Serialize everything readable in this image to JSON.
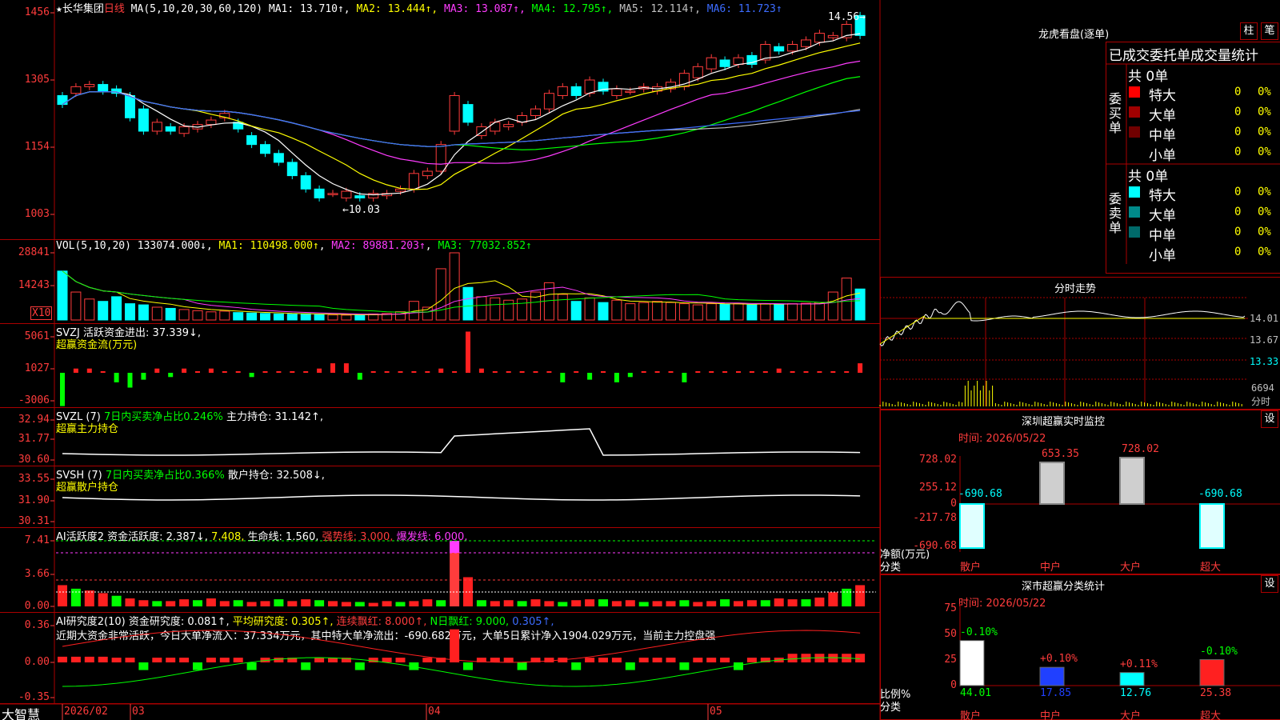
{
  "main": {
    "stock_name": "★长华集团",
    "period": "日线",
    "ma_label": "MA(5,10,20,30,60,120)",
    "ma_values": [
      {
        "name": "MA1",
        "value": "13.710",
        "arrow": "↑",
        "color": "#ffffff"
      },
      {
        "name": "MA2",
        "value": "13.444",
        "arrow": "↑",
        "color": "#ffff00"
      },
      {
        "name": "MA3",
        "value": "13.087",
        "arrow": "↑",
        "color": "#ff3cff"
      },
      {
        "name": "MA4",
        "value": "12.795",
        "arrow": "↑",
        "color": "#00ff00"
      },
      {
        "name": "MA5",
        "value": "12.114",
        "arrow": "↑",
        "color": "#c0c0c0"
      },
      {
        "name": "MA6",
        "value": "11.723",
        "arrow": "↑",
        "color": "#3c6cff"
      }
    ],
    "y_ticks": [
      "1456",
      "1305",
      "1154",
      "1003"
    ],
    "high_label": "14.56",
    "low_label": "10.03"
  },
  "vol": {
    "label": "VOL(5,10,20)",
    "value": "133074.000↓",
    "ma1": "MA1: 110498.000↑",
    "ma2": "MA2: 89881.203↑",
    "ma3": "MA3: 77032.852↑",
    "y_ticks": [
      "28841",
      "14243"
    ],
    "unit": "X10"
  },
  "svzj": {
    "label": "SVZJ",
    "text": "活跃资金进出: 37.339↓,",
    "sub": "超赢资金流(万元)",
    "y_ticks": [
      "5061",
      "1027",
      "-3006"
    ]
  },
  "svzl": {
    "label": "SVZL (7)",
    "text1": "7日内买卖净占比0.246%",
    "text2": "主力持仓: 31.142↑,",
    "sub": "超赢主力持仓",
    "y_ticks": [
      "32.94",
      "31.77",
      "30.60"
    ]
  },
  "svsh": {
    "label": "SVSH (7)",
    "text1": "7日内买卖净占比0.366%",
    "text2": "散户持仓: 32.508↓,",
    "sub": "超赢散户持仓",
    "y_ticks": [
      "33.55",
      "31.90",
      "30.31"
    ]
  },
  "ai1": {
    "label": "AI活跃度2",
    "text1": "资金活跃度: 2.387↓,",
    "text2": "7.408,",
    "text3": "生命线: 1.560,",
    "text4": "强势线: 3.000,",
    "text5": "爆发线: 6.000,",
    "y_ticks": [
      "7.41",
      "3.66",
      "0.00"
    ]
  },
  "ai2": {
    "label": "AI研究度2(10)",
    "text1": "资金研究度: 0.081↑,",
    "text2": "平均研究度: 0.305↑,",
    "text3": "连续飘红: 8.000↑,",
    "text4": "N日飘红: 9.000,",
    "text5": "0.305↑,",
    "comment": "近期大资金非常活跃，今日大单净流入：37.334万元，其中特大单净流出：-690.682万元，大单5日累计净入1904.029万元，当前主力控盘强",
    "y_ticks": [
      "0.36",
      "0.00",
      "-0.35"
    ]
  },
  "xaxis": {
    "brand": "大智慧",
    "labels": [
      "2026/02",
      "03",
      "04",
      "05"
    ]
  },
  "lhb": {
    "title": "龙虎看盘(逐单)",
    "btn1": "柱",
    "btn2": "笔",
    "header": "已成交委托单成交量统计",
    "buy_label": "委买单",
    "sell_label": "委卖单",
    "buy_total": "共 0单",
    "sell_total": "共 0单",
    "buy_rows": [
      {
        "name": "特大",
        "count": "0",
        "pct": "0%",
        "color": "#ff0000"
      },
      {
        "name": "大单",
        "count": "0",
        "pct": "0%",
        "color": "#a00000"
      },
      {
        "name": "中单",
        "count": "0",
        "pct": "0%",
        "color": "#700000"
      },
      {
        "name": "小单",
        "count": "0",
        "pct": "0%",
        "color": "#000000"
      }
    ],
    "sell_rows": [
      {
        "name": "特大",
        "count": "0",
        "pct": "0%",
        "color": "#00ffff"
      },
      {
        "name": "大单",
        "count": "0",
        "pct": "0%",
        "color": "#008a8a"
      },
      {
        "name": "中单",
        "count": "0",
        "pct": "0%",
        "color": "#006a6a"
      },
      {
        "name": "小单",
        "count": "0",
        "pct": "0%",
        "color": "#000000"
      }
    ]
  },
  "fs": {
    "title": "分时走势",
    "y_ticks": [
      "14.01",
      "13.67",
      "13.33"
    ],
    "vol_tick": "6694",
    "vol_label": "分时"
  },
  "szmon": {
    "title": "深圳超赢实时监控",
    "btn": "设",
    "time": "时间: 2026/05/22",
    "y_ticks": [
      "728.02",
      "255.12",
      "0",
      "-217.78",
      "-690.68"
    ],
    "y_label": "净额(万元)",
    "x_label": "分类",
    "bars": [
      {
        "name": "散户",
        "value": -690.68,
        "label": "-690.68"
      },
      {
        "name": "中户",
        "value": 653.35,
        "label": "653.35"
      },
      {
        "name": "大户",
        "value": 728.02,
        "label": "728.02"
      },
      {
        "name": "超大",
        "value": -690.68,
        "label": "-690.68"
      }
    ]
  },
  "szcls": {
    "title": "深市超赢分类统计",
    "btn": "设",
    "time": "时间: 2026/05/22",
    "y_ticks": [
      "75",
      "50",
      "25",
      "0"
    ],
    "y_label": "比例%",
    "x_label": "分类",
    "bars": [
      {
        "name": "散户",
        "value": 44.01,
        "change": "-0.10%",
        "color": "#ffffff"
      },
      {
        "name": "中户",
        "value": 17.85,
        "change": "+0.10%",
        "color": "#2040ff"
      },
      {
        "name": "大户",
        "value": 12.76,
        "change": "+0.11%",
        "color": "#00ffff"
      },
      {
        "name": "超大",
        "value": 25.38,
        "change": "-0.10%",
        "color": "#ff2020"
      }
    ]
  },
  "chart_data": [
    {
      "type": "candlestick",
      "title": "长华集团 日线",
      "ylim": [
        10.03,
        14.56
      ],
      "open": [
        12.7,
        12.75,
        12.9,
        12.95,
        12.85,
        12.7,
        12.4,
        11.9,
        12.0,
        11.85,
        11.95,
        12.05,
        12.2,
        12.1,
        11.8,
        11.6,
        11.4,
        11.2,
        10.9,
        10.6,
        10.5,
        10.4,
        10.45,
        10.4,
        10.45,
        10.55,
        10.6,
        10.9,
        11.0,
        11.9,
        12.5,
        11.8,
        11.9,
        12.0,
        12.1,
        12.25,
        12.4,
        12.7,
        12.9,
        12.75,
        13.0,
        12.7,
        12.8,
        12.85,
        12.8,
        12.85,
        12.9,
        13.1,
        13.3,
        13.5,
        13.4,
        13.6,
        13.5,
        13.8,
        13.7,
        13.8,
        13.9,
        14.0,
        14.0,
        14.5
      ],
      "close": [
        12.5,
        12.9,
        12.95,
        12.8,
        12.75,
        12.2,
        11.9,
        12.1,
        11.9,
        12.0,
        12.05,
        12.15,
        12.3,
        11.95,
        11.6,
        11.4,
        11.2,
        10.9,
        10.6,
        10.4,
        10.5,
        10.55,
        10.4,
        10.5,
        10.5,
        10.6,
        10.95,
        11.0,
        11.6,
        12.7,
        12.1,
        12.0,
        12.1,
        12.05,
        12.25,
        12.4,
        12.75,
        12.9,
        12.7,
        13.05,
        12.8,
        12.85,
        12.8,
        12.9,
        12.9,
        13.0,
        13.2,
        13.35,
        13.55,
        13.35,
        13.55,
        13.4,
        13.85,
        13.7,
        13.85,
        13.95,
        14.1,
        14.05,
        14.3,
        14.05
      ],
      "volume_x10": [
        21000,
        12000,
        9000,
        8000,
        10000,
        7000,
        6500,
        5500,
        5000,
        4500,
        4000,
        3500,
        3800,
        3200,
        3000,
        2800,
        2600,
        2500,
        2700,
        2300,
        2200,
        2100,
        2000,
        2600,
        2800,
        3600,
        8000,
        5500,
        22000,
        28841,
        14000,
        10000,
        9500,
        8500,
        9000,
        12000,
        16000,
        11000,
        8000,
        9500,
        7500,
        8500,
        7000,
        7500,
        8000,
        7500,
        7000,
        6500,
        7000,
        6800,
        7200,
        6500,
        7000,
        6600,
        7000,
        7200,
        7500,
        12000,
        18000,
        13307
      ],
      "ma": {
        "MA1": 13.71,
        "MA2": 13.444,
        "MA3": 13.087,
        "MA4": 12.795,
        "MA5": 12.114,
        "MA6": 11.723
      }
    }
  ]
}
